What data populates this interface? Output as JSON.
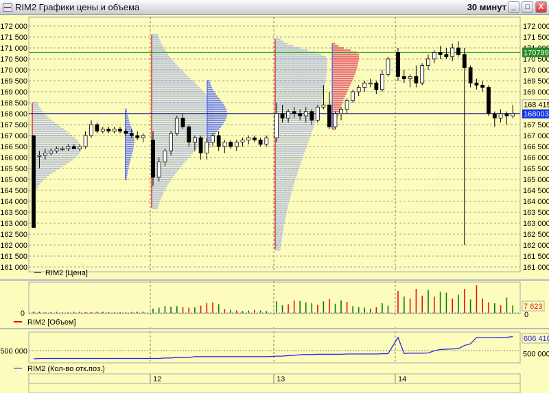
{
  "window": {
    "title": "RIM2 Графики цены и объема",
    "interval": "30 минут",
    "min": "_",
    "max": "□",
    "close": "X"
  },
  "chart_data": {
    "type": "candlestick",
    "price_panel": {
      "legend": "RIM2 [Цена]",
      "ylim": [
        161000,
        172000
      ],
      "yticks": [
        "172 000",
        "171 500",
        "171 000",
        "170 500",
        "170 000",
        "169 500",
        "169 000",
        "168 500",
        "168 000",
        "167 500",
        "167 000",
        "166 500",
        "166 000",
        "165 500",
        "165 000",
        "164 500",
        "164 000",
        "163 500",
        "163 000",
        "162 500",
        "162 000",
        "161 500",
        "161 000"
      ],
      "ytick_values": [
        172000,
        171500,
        171000,
        170500,
        170000,
        169500,
        169000,
        168500,
        168000,
        167500,
        167000,
        166500,
        166000,
        165500,
        165000,
        164500,
        164000,
        163500,
        163000,
        162500,
        162000,
        161500,
        161000
      ],
      "green_line": {
        "value": 170799,
        "label": "170799."
      },
      "blue_line": {
        "value": 168003,
        "label": "168003."
      },
      "extra_label": "168 415",
      "candles": [
        [
          167000,
          167000,
          162800,
          162800
        ],
        [
          166100,
          166300,
          165500,
          166100
        ],
        [
          166100,
          166400,
          165900,
          166200
        ],
        [
          166200,
          166400,
          166100,
          166300
        ],
        [
          166300,
          166500,
          166200,
          166400
        ],
        [
          166400,
          166500,
          166300,
          166400
        ],
        [
          166400,
          166600,
          166300,
          166500
        ],
        [
          166500,
          166600,
          166400,
          166400
        ],
        [
          166400,
          166600,
          166300,
          166500
        ],
        [
          166500,
          167200,
          166400,
          167000
        ],
        [
          167000,
          167700,
          166900,
          167500
        ],
        [
          167500,
          167600,
          167100,
          167200
        ],
        [
          167200,
          167400,
          167100,
          167300
        ],
        [
          167300,
          167400,
          167100,
          167200
        ],
        [
          167200,
          167400,
          167100,
          167300
        ],
        [
          167300,
          167400,
          167100,
          167200
        ],
        [
          167200,
          167300,
          167000,
          167100
        ],
        [
          167100,
          167300,
          166900,
          167000
        ],
        [
          167000,
          167200,
          166800,
          166900
        ],
        [
          166900,
          167100,
          166700,
          167000
        ],
        [
          166800,
          167200,
          164700,
          165100
        ],
        [
          165100,
          166000,
          164900,
          165800
        ],
        [
          165800,
          166400,
          165600,
          166300
        ],
        [
          166300,
          167200,
          166100,
          167100
        ],
        [
          167100,
          167900,
          167000,
          167800
        ],
        [
          167800,
          168000,
          167300,
          167400
        ],
        [
          167400,
          167500,
          166500,
          166700
        ],
        [
          166700,
          167000,
          166300,
          166900
        ],
        [
          166900,
          167000,
          165900,
          166200
        ],
        [
          166200,
          166900,
          165900,
          166700
        ],
        [
          166700,
          167100,
          166500,
          167000
        ],
        [
          167000,
          167200,
          166300,
          166500
        ],
        [
          166500,
          166800,
          166200,
          166700
        ],
        [
          166700,
          166800,
          166400,
          166500
        ],
        [
          166500,
          166800,
          166300,
          166700
        ],
        [
          166700,
          166900,
          166500,
          166800
        ],
        [
          166800,
          167000,
          166600,
          166900
        ],
        [
          166900,
          167000,
          166700,
          166800
        ],
        [
          166800,
          166900,
          166500,
          166600
        ],
        [
          166600,
          167000,
          166500,
          166900
        ],
        [
          166900,
          168500,
          166700,
          168000
        ],
        [
          168000,
          168400,
          167600,
          167800
        ],
        [
          167800,
          168200,
          167600,
          168100
        ],
        [
          168100,
          168300,
          167800,
          168000
        ],
        [
          168000,
          168200,
          167700,
          167900
        ],
        [
          167900,
          168300,
          167600,
          168100
        ],
        [
          168100,
          168200,
          167500,
          167700
        ],
        [
          167700,
          168400,
          167600,
          168300
        ],
        [
          168300,
          169300,
          168200,
          168400
        ],
        [
          168400,
          169000,
          167300,
          167400
        ],
        [
          167400,
          168100,
          167300,
          168000
        ],
        [
          168000,
          168300,
          167700,
          168200
        ],
        [
          168200,
          168700,
          168000,
          168600
        ],
        [
          168600,
          169100,
          168500,
          169000
        ],
        [
          169000,
          169300,
          168800,
          169200
        ],
        [
          169200,
          169500,
          169000,
          169400
        ],
        [
          169400,
          169600,
          169200,
          169400
        ],
        [
          169400,
          169500,
          168900,
          169100
        ],
        [
          169100,
          170000,
          169000,
          169800
        ],
        [
          169800,
          170600,
          169700,
          170500
        ],
        [
          170800,
          171000,
          169500,
          169700
        ],
        [
          169700,
          170000,
          169400,
          169600
        ],
        [
          169600,
          169800,
          169200,
          169700
        ],
        [
          169700,
          170200,
          169200,
          169400
        ],
        [
          169400,
          170300,
          169300,
          170200
        ],
        [
          170200,
          170700,
          170000,
          170500
        ],
        [
          170500,
          170900,
          170300,
          170800
        ],
        [
          170800,
          171100,
          170500,
          170700
        ],
        [
          170700,
          171000,
          170500,
          170600
        ],
        [
          170600,
          171200,
          170400,
          171000
        ],
        [
          171000,
          171300,
          170600,
          170700
        ],
        [
          170700,
          171000,
          162000,
          170100
        ],
        [
          170100,
          170200,
          169200,
          169400
        ],
        [
          169400,
          169600,
          169100,
          169300
        ],
        [
          169300,
          169500,
          169000,
          169200
        ],
        [
          169200,
          169300,
          167900,
          168000
        ],
        [
          168000,
          168100,
          167400,
          167800
        ],
        [
          167800,
          168200,
          167600,
          168000
        ],
        [
          168000,
          168100,
          167500,
          167900
        ],
        [
          167900,
          168400,
          167800,
          168003
        ]
      ],
      "profiles": [
        {
          "day": 0,
          "low": 164600,
          "high": 168500,
          "poc": 166400,
          "max": 70,
          "color": "#8c9cf0"
        },
        {
          "day": 1,
          "low": 163700,
          "high": 171600,
          "poc": 168000,
          "max": 90,
          "color": "#8c9cf0"
        },
        {
          "day": 2,
          "low": 161800,
          "high": 171400,
          "poc": 170500,
          "max": 75,
          "color": "#8c9cf0"
        },
        {
          "day": 0.78,
          "low": 165000,
          "high": 168200,
          "poc": 166800,
          "max": 12,
          "color": "#7080f0"
        },
        {
          "day": 1.45,
          "low": 166500,
          "high": 169500,
          "poc": 168000,
          "max": 28,
          "color": "#7080f0"
        },
        {
          "day": 2.47,
          "low": 167300,
          "high": 171200,
          "poc": 170700,
          "max": 38,
          "color": "#e86070"
        }
      ]
    },
    "volume_panel": {
      "legend": "RIM2 [Объем]",
      "zero_label": "0",
      "right_zero": "0",
      "last_label": "7 623",
      "ymax": 30000,
      "values": [
        1500,
        1200,
        900,
        1000,
        1100,
        800,
        900,
        1000,
        1200,
        900,
        1000,
        1300,
        1100,
        900,
        1000,
        800,
        900,
        1000,
        1200,
        1400,
        4500,
        5500,
        7000,
        6500,
        7000,
        6000,
        5500,
        6000,
        7500,
        10500,
        11000,
        9000,
        4000,
        3000,
        2500,
        2000,
        2500,
        3000,
        2500,
        2000,
        12000,
        8000,
        9000,
        13000,
        12500,
        11000,
        10000,
        8500,
        12000,
        14500,
        9500,
        13000,
        11500,
        7000,
        6000,
        5500,
        4500,
        6000,
        10000,
        7500,
        23000,
        17000,
        15000,
        25000,
        18000,
        24000,
        17000,
        22000,
        21000,
        15000,
        19000,
        25000,
        14000,
        29000,
        15000,
        11000,
        10000,
        8000,
        16000,
        7623
      ],
      "colors": "gggggrrgrrrgggrgrggr gggggrrgrrrgrgrggrgg ggrrgggrgrggrggggrgg rgrrrgrggrgrgrrrgrgg"
    },
    "oi_panel": {
      "legend": "RIM2 (Кол-во отк.поз.)",
      "ytick": "500 000",
      "ytick_value": 500000,
      "right_tick": "500 000",
      "last_label": "606 410",
      "ylim": [
        430000,
        630000
      ],
      "values": [
        440000,
        442000,
        443000,
        443000,
        443000,
        443000,
        443000,
        443000,
        443000,
        443000,
        443000,
        443000,
        443000,
        443000,
        443000,
        443000,
        443000,
        443000,
        443000,
        443000,
        443000,
        443000,
        446000,
        446000,
        450000,
        450000,
        450000,
        456000,
        456000,
        456000,
        456000,
        456000,
        456000,
        456000,
        456000,
        456000,
        456000,
        456000,
        456000,
        456000,
        460000,
        460000,
        464000,
        466000,
        470000,
        472000,
        472000,
        474000,
        474000,
        474000,
        474000,
        474000,
        476000,
        476000,
        476000,
        476000,
        476000,
        476000,
        478000,
        478000,
        600000,
        480000,
        482000,
        482000,
        482000,
        484000,
        500000,
        510000,
        512000,
        514000,
        516000,
        540000,
        552000,
        600000,
        600000,
        598000,
        600000,
        601000,
        601000,
        606410
      ]
    },
    "x_axis": {
      "labels": [
        "12",
        "13",
        "14"
      ]
    }
  }
}
